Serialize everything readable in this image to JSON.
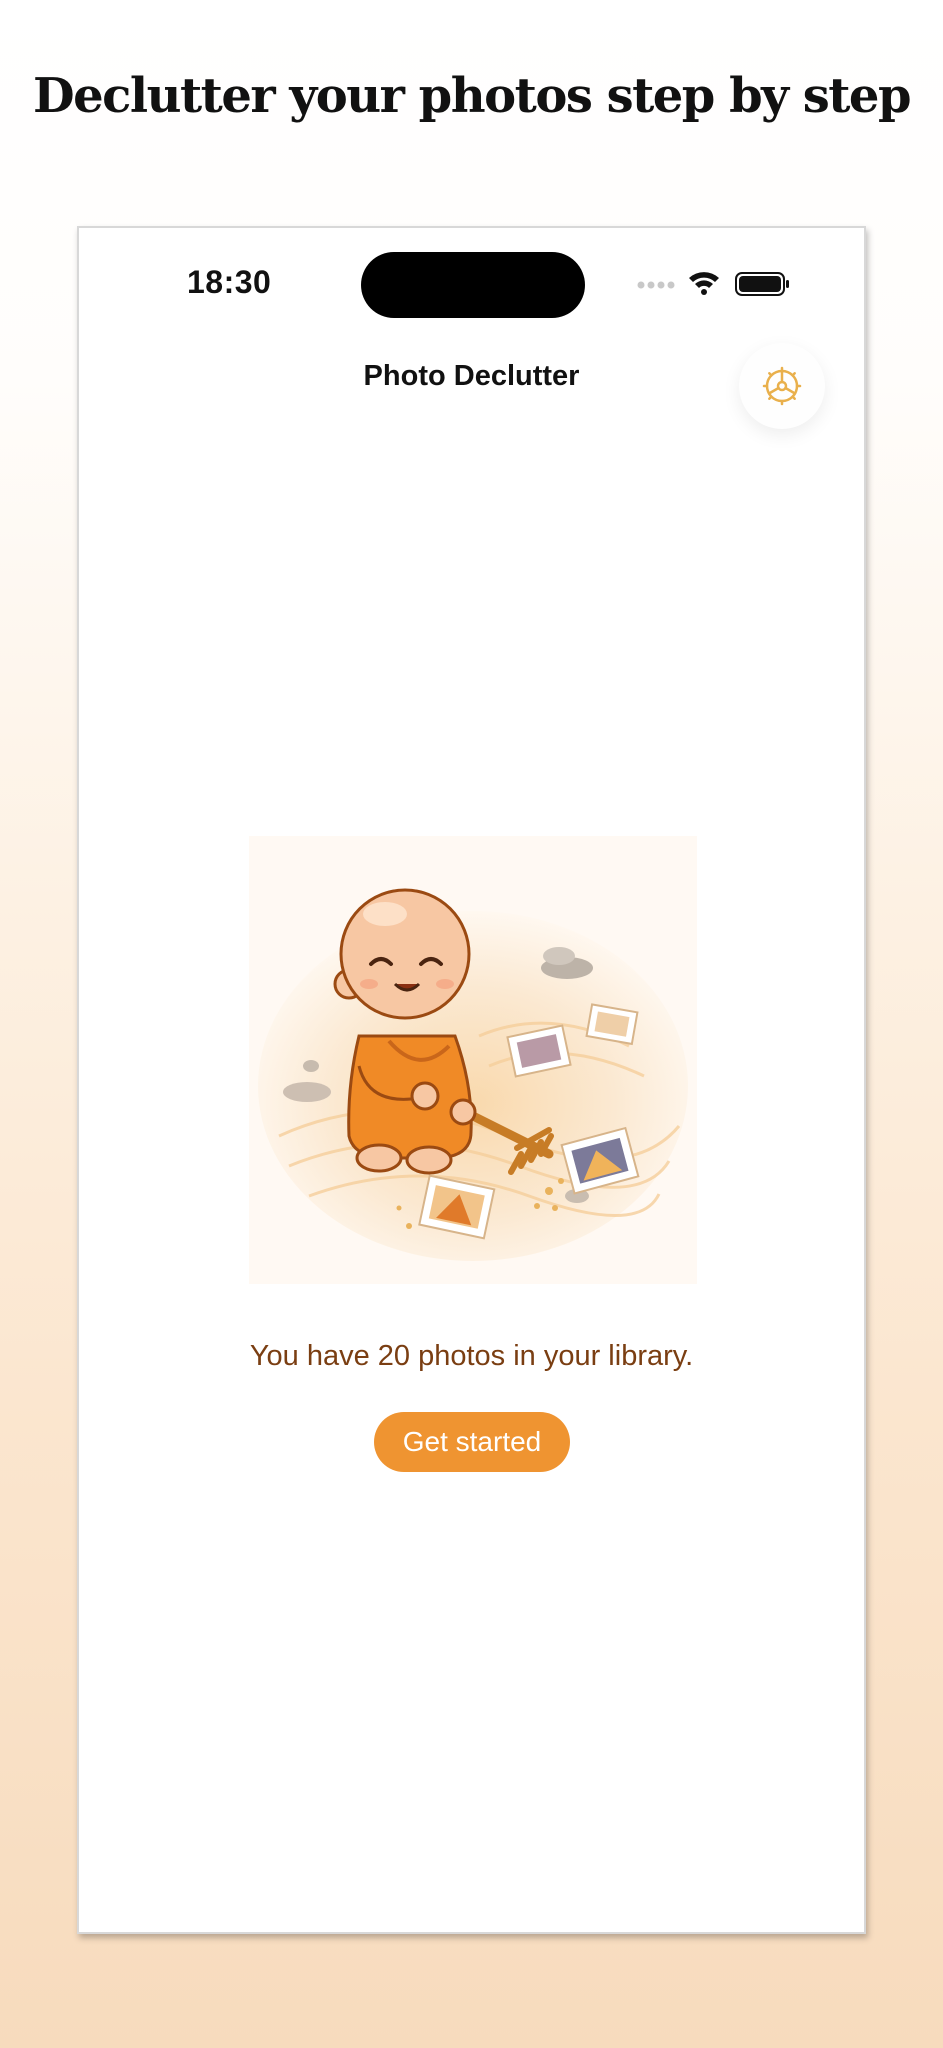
{
  "headline": "Declutter your photos step by step",
  "status_bar": {
    "time": "18:30"
  },
  "nav": {
    "title": "Photo Declutter",
    "settings_icon": "gear-icon"
  },
  "main": {
    "photo_count_text": "You have 20 photos in your library.",
    "cta_label": "Get started"
  },
  "colors": {
    "accent": "#ef9431",
    "count_text": "#7a3e12",
    "gear": "#e9b04c"
  }
}
